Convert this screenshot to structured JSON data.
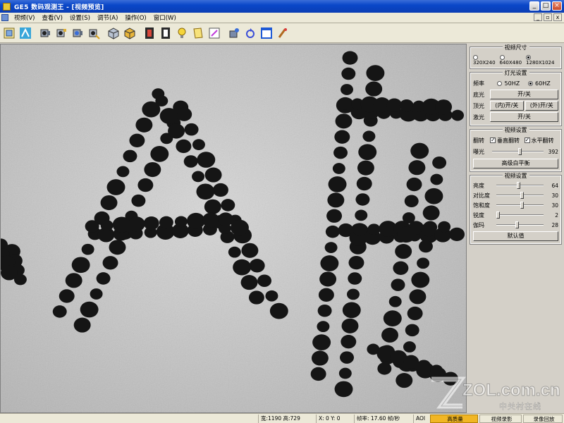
{
  "window": {
    "title": "GE5 数码观测王 - [视频预览]",
    "minimize": "_",
    "maximize": "□",
    "close": "×"
  },
  "menubar": {
    "items": [
      "视频(V)",
      "查看(V)",
      "设置(S)",
      "调节(A)",
      "操作(O)",
      "窗口(W)"
    ],
    "mdi_min": "_",
    "mdi_restore": "▫",
    "mdi_close": "x"
  },
  "toolbar": {
    "tools": [
      "capture-icon",
      "measure-icon",
      "camera-icon",
      "camera-settings-icon",
      "camera-video-icon",
      "camera-tools-icon",
      "cube-icon",
      "cube-color-icon",
      "film-icon",
      "film-save-icon",
      "lightbulb-icon",
      "note-icon",
      "edit-icon",
      "3d-view-icon",
      "rotate-icon",
      "window-icon",
      "brush-icon"
    ]
  },
  "panel": {
    "video_size": {
      "title": "视频尺寸",
      "options": [
        "320X240",
        "640X480",
        "1280X1024"
      ],
      "selected": "1280X1024"
    },
    "light": {
      "title": "灯光设置",
      "freq_label": "频率",
      "freq_options": [
        "50HZ",
        "60HZ"
      ],
      "freq_selected": "60HZ",
      "bottom_label": "底光",
      "bottom_button": "开/关",
      "top_label": "顶光",
      "top_inner_button": "(内)开/关",
      "top_outer_button": "(外)开/关",
      "laser_label": "激光",
      "laser_button": "开/关"
    },
    "video_set": {
      "title": "视频设置",
      "flip_label": "翻转",
      "vflip_label": "垂直翻转",
      "vflip_checked": true,
      "hflip_label": "水平翻转",
      "hflip_checked": true,
      "exposure_label": "曝光",
      "exposure_value": "392",
      "exposure_level": 0.55,
      "white_balance_button": "高级白平衡"
    },
    "video_adjust": {
      "title": "视频设置",
      "sliders": [
        {
          "label": "亮度",
          "value": "64",
          "level": 0.48
        },
        {
          "label": "对比度",
          "value": "30",
          "level": 0.55
        },
        {
          "label": "饱和度",
          "value": "30",
          "level": 0.55
        },
        {
          "label": "锐度",
          "value": "2",
          "level": 0.05
        },
        {
          "label": "伽玛",
          "value": "28",
          "level": 0.45
        }
      ],
      "default_button": "默认值"
    }
  },
  "statusbar": {
    "size": "宽:1190 高:729",
    "coords": "X: 0 Y: 0",
    "framerate": "帧率: 17.60 帧/秒",
    "aoi": "AOI",
    "hq": "高质量",
    "record": "视频录影",
    "playback": "录像回放"
  },
  "watermark": {
    "main": "ZOL.com.cn",
    "sub": "中关村在线"
  },
  "colors": {
    "title_bar": "#0a47c9",
    "status_active": "#f1b624",
    "chrome": "#ece9d8",
    "panel": "#d4d0c8"
  }
}
